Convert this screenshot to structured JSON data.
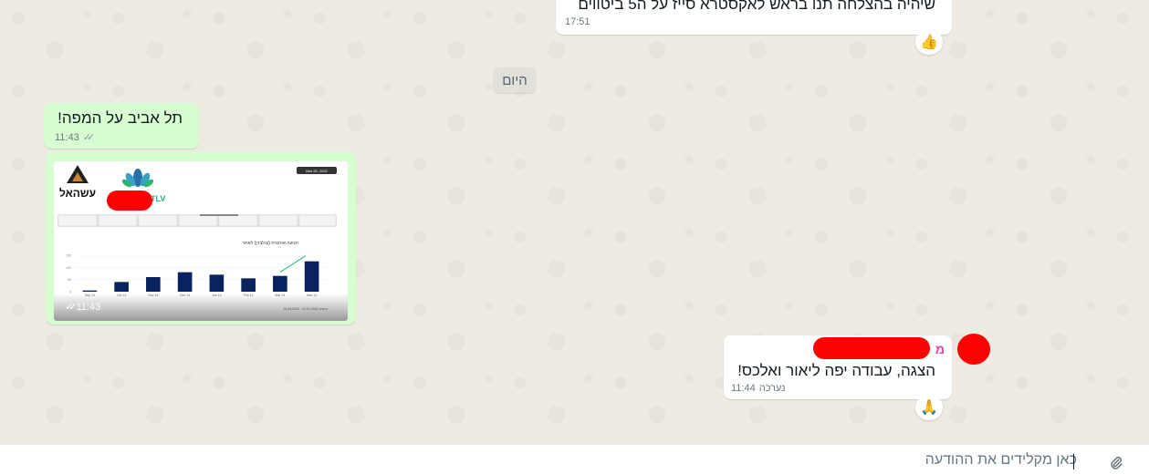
{
  "messages": [
    {
      "text": "שיהיה בהצלחה תנו בראש לאקסטרא סייז על ה5 ביטווים",
      "time": "17:51",
      "reaction": "👍"
    },
    {
      "text": "תל אביב על המפה!",
      "time": "11:43"
    },
    {
      "type": "image",
      "time": "11:43"
    },
    {
      "sender": "מ",
      "text": "הצגה, עבודה יפה ליאור ואלכס!",
      "edited_label": "נערכה",
      "time": "11:44",
      "reaction": "🙏"
    }
  ],
  "day_divider": "היום",
  "thumbnail": {
    "logo_text": "עשהאל",
    "brand_text": "TLV",
    "chart_title": "תנועה אורגנית (ובלבדן) לאתר",
    "date_chip": "Mar 25, 2022",
    "footer_left": "נתונים 01.01.2022 - 31.03.2022",
    "footer_right": "Page 1 / 1"
  },
  "chart_data": {
    "type": "bar",
    "categories": [
      "Sep 14",
      "Oct 14",
      "Nov 14",
      "Dec 14",
      "Jan 14",
      "Feb 14",
      "Mar 14",
      "Mar 14"
    ],
    "values": [
      5,
      40,
      60,
      80,
      70,
      55,
      65,
      125
    ],
    "ylim": [
      0,
      150
    ],
    "yticks": [
      "150",
      "100",
      "50",
      "0"
    ],
    "colors": {
      "bar": "#0b2260",
      "trend": "#2bb673"
    }
  },
  "compose": {
    "placeholder": "כאן מקלידים את ההודעה"
  }
}
